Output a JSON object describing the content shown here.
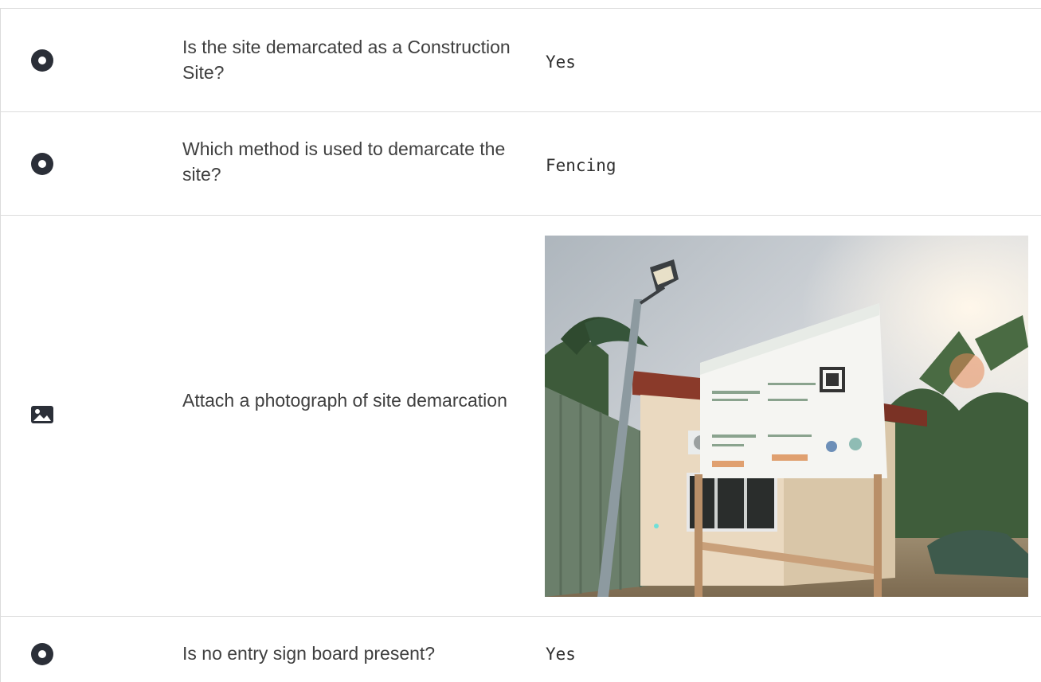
{
  "rows": [
    {
      "icon": "radio-icon",
      "question": "Is the site demarcated as a Construction Site?",
      "answer": "Yes"
    },
    {
      "icon": "radio-icon",
      "question": "Which method is used to demarcate the site?",
      "answer": "Fencing"
    },
    {
      "icon": "image-icon",
      "question": "Attach a photograph of site demarcation",
      "answer_type": "photo"
    },
    {
      "icon": "radio-icon",
      "question": "Is no entry sign board present?",
      "answer": "Yes"
    }
  ]
}
